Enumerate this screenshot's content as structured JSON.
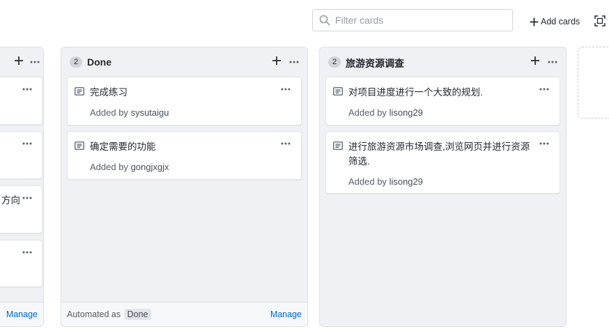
{
  "toolbar": {
    "filter_placeholder": "Filter cards",
    "add_cards_label": "Add cards"
  },
  "columns": {
    "left": {
      "cards": [
        {
          "title": ""
        },
        {
          "title": ""
        },
        {
          "title_fragment": "方向"
        },
        {
          "title": ""
        }
      ],
      "footer": {
        "manage_label": "Manage"
      }
    },
    "done": {
      "count": "2",
      "title": "Done",
      "cards": [
        {
          "title": "完成练习",
          "added_prefix": "Added by",
          "author": "sysutaigu"
        },
        {
          "title": "确定需要的功能",
          "added_prefix": "Added by",
          "author": "gongjxgjx"
        }
      ],
      "footer": {
        "automated_prefix": "Automated as",
        "automated_tag": "Done",
        "manage_label": "Manage"
      }
    },
    "travel": {
      "count": "2",
      "title": "旅游资源调查",
      "cards": [
        {
          "title": "对项目进度进行一个大致的规划.",
          "added_prefix": "Added by",
          "author": "lisong29"
        },
        {
          "title_line1": "进行旅游资源市场调查,浏览网页并进行资源",
          "title_line2": "筛选.",
          "added_prefix": "Added by",
          "author": "lisong29"
        }
      ]
    }
  },
  "colors": {
    "column_bg": "#eff1f4",
    "card_border": "#e1e4e8",
    "link": "#0366d6",
    "muted_text": "#586069"
  },
  "icons": [
    "search-icon",
    "plus-icon",
    "fullscreen-icon",
    "kebab-menu-icon",
    "note-icon"
  ]
}
